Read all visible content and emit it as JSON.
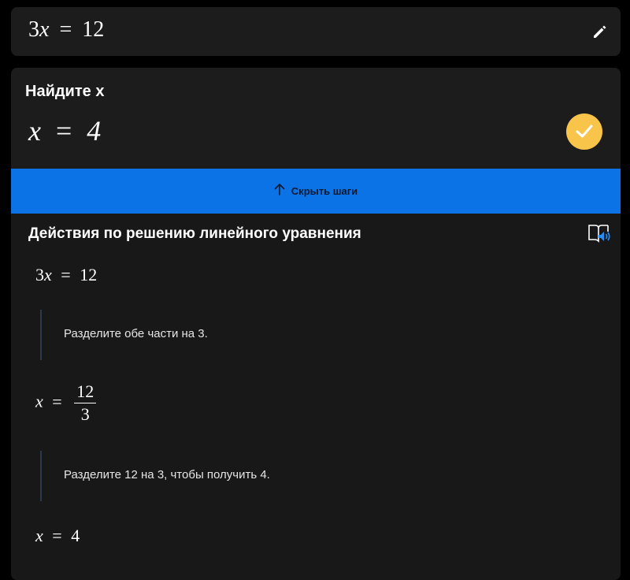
{
  "input": {
    "coef": "3",
    "var": "x",
    "eq_sign": "=",
    "rhs": "12",
    "edit_icon": "pencil-icon"
  },
  "result": {
    "title": "Найдите x",
    "answer_var": "x",
    "answer_eq": "=",
    "answer_value": "4",
    "badge_color": "#f8c54a",
    "badge_icon": "check-icon"
  },
  "steps_toggle": {
    "label": "Скрыть шаги",
    "icon": "arrow-up-icon",
    "color": "#0b73e5"
  },
  "steps": {
    "title": "Действия по решению линейного уравнения",
    "reader_icon": "immersive-reader-icon",
    "items": [
      {
        "coef": "3",
        "var": "x",
        "eq": "=",
        "rhs": "12"
      },
      {
        "note": "Разделите обе части на 3."
      },
      {
        "var": "x",
        "eq": "=",
        "num": "12",
        "den": "3"
      },
      {
        "note": "Разделите 12 на 3, чтобы получить 4."
      },
      {
        "var": "x",
        "eq": "=",
        "rhs": "4"
      }
    ]
  }
}
